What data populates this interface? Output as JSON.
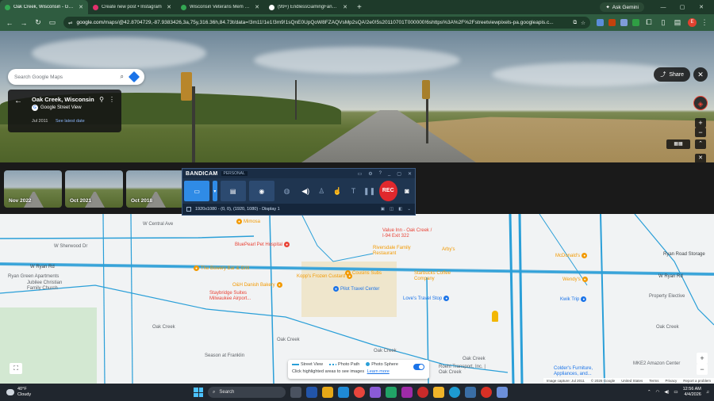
{
  "browser": {
    "tabs": [
      {
        "label": "Oak Creek, Wisconsin - Google",
        "active": true,
        "favicon_color": "#34a853"
      },
      {
        "label": "Create new post • Instagram",
        "active": false,
        "favicon_color": "#e1306c"
      },
      {
        "label": "Wisconsin Veterans Mem Hwy",
        "active": false,
        "favicon_color": "#34a853"
      },
      {
        "label": "(99+) EndlessGamingFanProdu",
        "active": false,
        "favicon_color": "#ffffff"
      }
    ],
    "new_tab": "+",
    "ask_gemini": "Ask Gemini",
    "url_host": "google.com",
    "url_path": "/maps/@42.8704729,-87.9383426,3a,75y,316.36h,84.73t/data=!3m11!1e1!3m9!1sQnE0UpQoW8FZAQVsMp2sQA!2e0!5s20110701T000000!6shttps%3A%2F%2Fstreetviewpixels-pa.googleapis.c...",
    "profile_initial": "E"
  },
  "streetview": {
    "search_placeholder": "Search Google Maps",
    "place_name": "Oak Creek, Wisconsin",
    "source": "Google Street View",
    "capture_date": "Jul 2011",
    "see_latest": "See latest date",
    "share_label": "Share"
  },
  "timeline": {
    "thumbnails": [
      {
        "date": "Nov 2022"
      },
      {
        "date": "Oct 2021"
      },
      {
        "date": "Oct 2018"
      }
    ]
  },
  "bandicam": {
    "app_name": "BANDICAM",
    "edition": "PERSONAL",
    "rec_label": "REC",
    "status": "1920x1080 - (0, 0), (1920, 1080) - Display 1"
  },
  "map": {
    "roads": [
      "W Central Ave",
      "W Sherwood Dr",
      "W Ryan Rd",
      "Ryan Road Storage",
      "W Ryan Rd",
      "Oak Creek",
      "Oak Creek",
      "Oak Creek",
      "Oak Creek",
      "Oak Creek"
    ],
    "places": [
      {
        "name": "Mimosa",
        "color": "#f29900"
      },
      {
        "name": "BluePearl Pet Hospital",
        "color": "#e94235"
      },
      {
        "name": "The Bowery Bar & Grill",
        "color": "#f29900"
      },
      {
        "name": "O&H Danish Bakery",
        "color": "#f29900"
      },
      {
        "name": "Staybridge Suites Milwaukee Airport...",
        "color": "#e94235"
      },
      {
        "name": "Kopp's Frozen Custard",
        "color": "#f29900"
      },
      {
        "name": "Cousins Subs",
        "color": "#f29900"
      },
      {
        "name": "Pilot Travel Center",
        "color": "#1a73e8"
      },
      {
        "name": "Love's Travel Stop",
        "color": "#1a73e8"
      },
      {
        "name": "Starbucks Coffee Company",
        "color": "#f29900"
      },
      {
        "name": "Value Inn - Oak Creek / I-94 Exit 322",
        "color": "#e94235"
      },
      {
        "name": "Riversdale Family Restaurant",
        "color": "#f29900"
      },
      {
        "name": "Arby's",
        "color": "#f29900"
      },
      {
        "name": "McDonald's",
        "color": "#f29900"
      },
      {
        "name": "Wendy's",
        "color": "#f29900"
      },
      {
        "name": "Kwik Trip",
        "color": "#1a73e8"
      },
      {
        "name": "Property Elective",
        "color": "#5f6368"
      },
      {
        "name": "Ryan Green Apartments",
        "color": "#5f6368"
      },
      {
        "name": "Jubilee Christian Family Church",
        "color": "#5f6368"
      },
      {
        "name": "Season at Franklin",
        "color": "#5f6368"
      },
      {
        "name": "Roehl Transport, Inc. | Oak Creek",
        "color": "#5f6368"
      },
      {
        "name": "Colder's Furniture, Appliances, and...",
        "color": "#1a73e8"
      },
      {
        "name": "MKE2 Amazon Center",
        "color": "#5f6368"
      }
    ],
    "legend": {
      "street_view": "Street View",
      "photo_path": "Photo Path",
      "photo_sphere": "Photo Sphere",
      "hint": "Click highlighted areas to see images",
      "learn_more": "Learn more"
    },
    "attribution": [
      "Image capture: Jul 2011",
      "© 2026 Google",
      "United States",
      "Terms",
      "Privacy",
      "Report a problem"
    ]
  },
  "taskbar": {
    "temperature": "40°F",
    "condition": "Cloudy",
    "search_label": "Search",
    "time": "12:56 AM",
    "date": "4/4/2026"
  },
  "colors": {
    "browser_frame": "#1e3a2a",
    "map_road": "#2a9fd8",
    "rec": "#e0282d"
  }
}
